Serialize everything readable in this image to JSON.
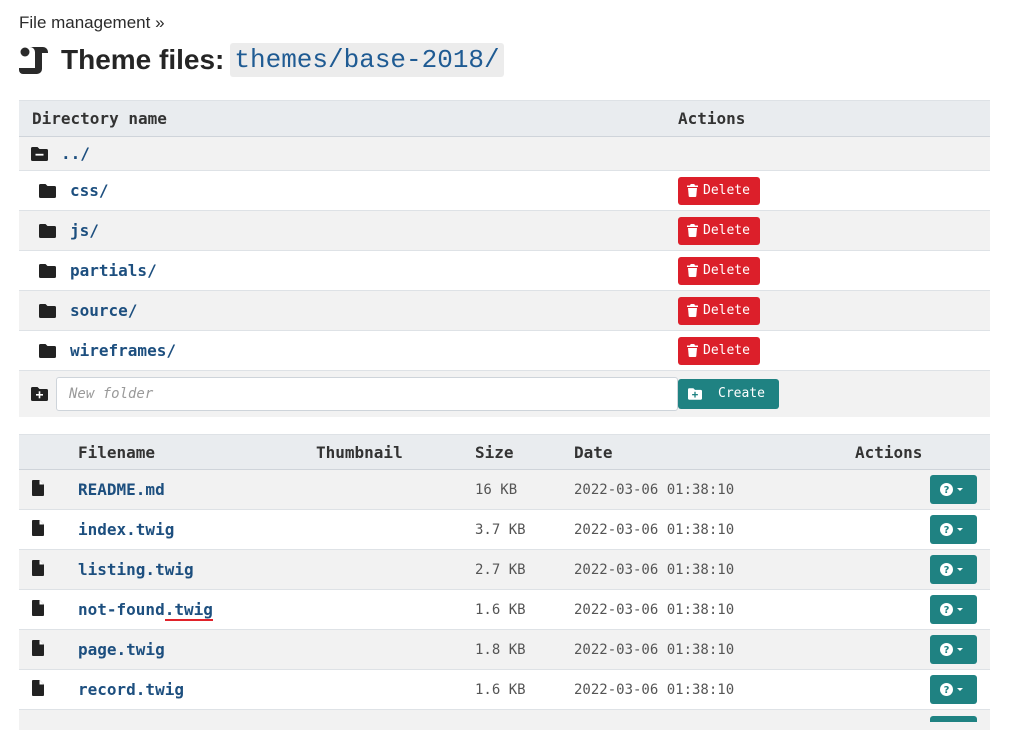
{
  "breadcrumb": {
    "label": "File management »"
  },
  "header": {
    "title": "Theme files:",
    "path": "themes/base-2018/"
  },
  "directories": {
    "col_name": "Directory name",
    "col_actions": "Actions",
    "parent": "../",
    "items": [
      {
        "name": "css/",
        "action": "Delete"
      },
      {
        "name": "js/",
        "action": "Delete"
      },
      {
        "name": "partials/",
        "action": "Delete"
      },
      {
        "name": "source/",
        "action": "Delete"
      },
      {
        "name": "wireframes/",
        "action": "Delete"
      }
    ],
    "new_folder_placeholder": "New folder",
    "create_label": "Create"
  },
  "files": {
    "col_filename": "Filename",
    "col_thumbnail": "Thumbnail",
    "col_size": "Size",
    "col_date": "Date",
    "col_actions": "Actions",
    "items": [
      {
        "name": "README.md",
        "size": "16 KB",
        "date": "2022-03-06 01:38:10"
      },
      {
        "name": "index.twig",
        "size": "3.7 KB",
        "date": "2022-03-06 01:38:10"
      },
      {
        "name": "listing.twig",
        "size": "2.7 KB",
        "date": "2022-03-06 01:38:10"
      },
      {
        "name_base": "not-found",
        "name_ext": ".twig",
        "size": "1.6 KB",
        "date": "2022-03-06 01:38:10"
      },
      {
        "name": "page.twig",
        "size": "1.8 KB",
        "date": "2022-03-06 01:38:10"
      },
      {
        "name": "record.twig",
        "size": "1.6 KB",
        "date": "2022-03-06 01:38:10"
      }
    ]
  },
  "colors": {
    "delete": "#dc1f2a",
    "teal": "#1f8282",
    "link": "#1d4f7f",
    "spellcheck_underline": "#e0222a"
  }
}
